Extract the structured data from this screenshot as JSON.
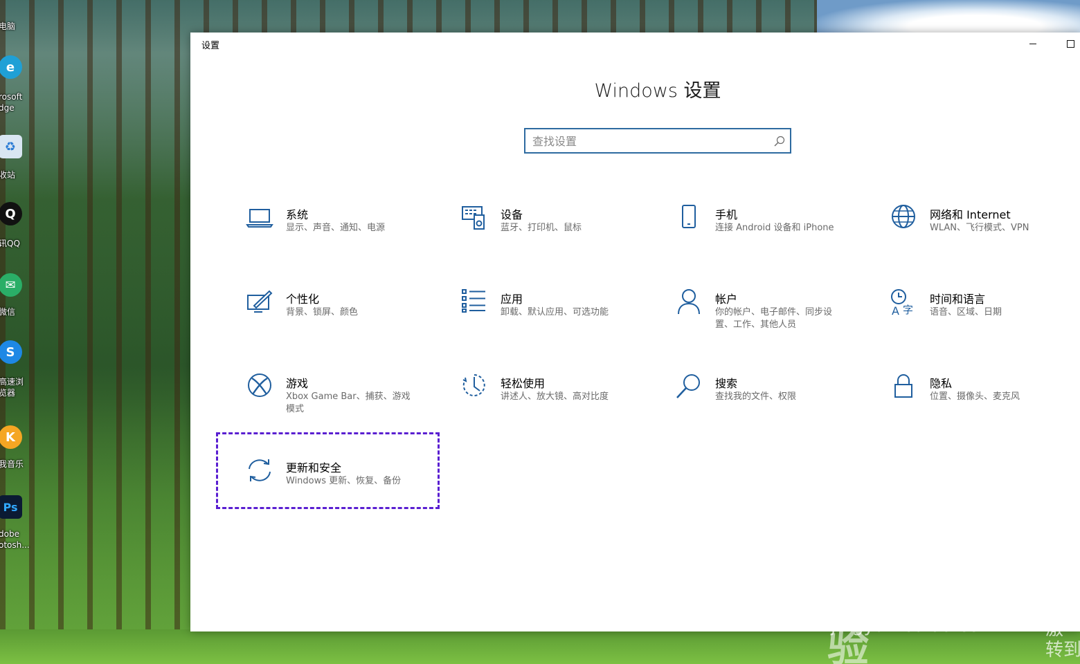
{
  "desktop": {
    "icons": [
      {
        "label": "电脑",
        "glyph": "🖥",
        "color": "#4a7fb5"
      },
      {
        "label": "rosoft\ndge",
        "glyph": "e",
        "color": "#1fa0d6"
      },
      {
        "label": "收站",
        "glyph": "♻",
        "color": "#5b9bd5"
      },
      {
        "label": "讯QQ",
        "glyph": "Q",
        "color": "#111111"
      },
      {
        "label": "微信",
        "glyph": "✉",
        "color": "#2aae67"
      },
      {
        "label": "高速浏\n览器",
        "glyph": "S",
        "color": "#1e88e5"
      },
      {
        "label": "我音乐",
        "glyph": "K",
        "color": "#f5a623"
      },
      {
        "label": "dobe\notosh...",
        "glyph": "Ps",
        "color": "#0b1a33"
      }
    ]
  },
  "window": {
    "title": "设置",
    "minimize_label": "",
    "maximize_label": ""
  },
  "main": {
    "heading": "Windows 设置",
    "search_placeholder": "查找设置"
  },
  "tiles": [
    {
      "title": "系统",
      "desc": "显示、声音、通知、电源",
      "icon": "laptop-icon"
    },
    {
      "title": "设备",
      "desc": "蓝牙、打印机、鼠标",
      "icon": "devices-icon"
    },
    {
      "title": "手机",
      "desc": "连接 Android 设备和 iPhone",
      "icon": "phone-icon"
    },
    {
      "title": "网络和 Internet",
      "desc": "WLAN、飞行模式、VPN",
      "icon": "globe-icon"
    },
    {
      "title": "个性化",
      "desc": "背景、锁屏、颜色",
      "icon": "personalization-icon"
    },
    {
      "title": "应用",
      "desc": "卸载、默认应用、可选功能",
      "icon": "apps-list-icon"
    },
    {
      "title": "帐户",
      "desc": "你的帐户、电子邮件、同步设置、工作、其他人员",
      "icon": "person-icon"
    },
    {
      "title": "时间和语言",
      "desc": "语音、区域、日期",
      "icon": "time-language-icon"
    },
    {
      "title": "游戏",
      "desc": "Xbox Game Bar、捕获、游戏模式",
      "icon": "xbox-icon"
    },
    {
      "title": "轻松使用",
      "desc": "讲述人、放大镜、高对比度",
      "icon": "ease-of-access-icon"
    },
    {
      "title": "搜索",
      "desc": "查找我的文件、权限",
      "icon": "search-icon"
    },
    {
      "title": "隐私",
      "desc": "位置、摄像头、麦克风",
      "icon": "lock-icon"
    },
    {
      "title": "更新和安全",
      "desc": "Windows 更新、恢复、备份",
      "icon": "sync-icon"
    }
  ],
  "colors": {
    "accent": "#1f5e9e",
    "highlight_border": "#5a1fd1"
  },
  "watermark": {
    "brand": "Bai du 经验",
    "url": "jingyan.baidu.com",
    "activate": "激\n转到"
  }
}
